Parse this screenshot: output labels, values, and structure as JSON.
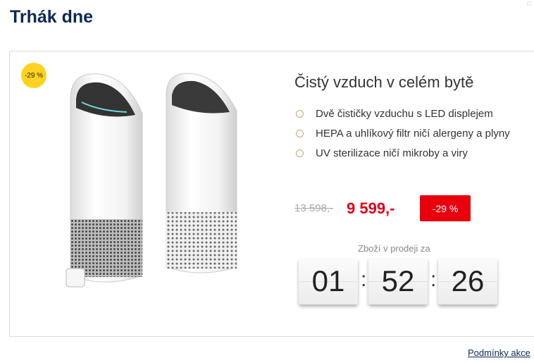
{
  "header": {
    "title": "Trhák dne"
  },
  "deal": {
    "badge": "-29 %",
    "product_image": "air-purifier-pair",
    "title": "Čistý vzduch v celém bytě",
    "features": [
      "Dvě čističky vzduchu s LED displejem",
      "HEPA a uhlíkový filtr ničí alergeny a plyny",
      "UV sterilizace ničí mikroby a viry"
    ],
    "old_price": "13 598,-",
    "new_price": "9 599,-",
    "discount": "-29 %",
    "countdown": {
      "label": "Zboží v prodeji za",
      "hours": "01",
      "minutes": "52",
      "seconds": "26",
      "separator": ":"
    }
  },
  "footer": {
    "terms_link": "Podmínky akce"
  },
  "colors": {
    "heading": "#0b2a55",
    "price_red": "#e0001b",
    "badge_yellow": "#ffd21f",
    "discount_red": "#e8000d",
    "bullet": "#c9a776"
  }
}
